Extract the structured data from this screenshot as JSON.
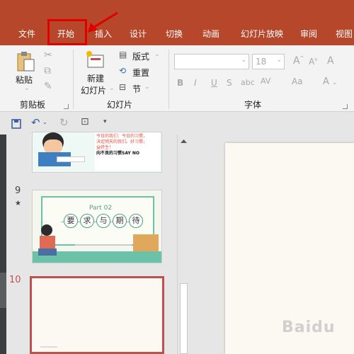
{
  "tabs": [
    "文件",
    "开始",
    "插入",
    "设计",
    "切换",
    "动画",
    "幻灯片放映",
    "审阅",
    "视图"
  ],
  "active_tab": "开始",
  "ribbon": {
    "clipboard": {
      "paste_label": "粘贴",
      "group_label": "剪贴板"
    },
    "slides": {
      "new_slide_line1": "新建",
      "new_slide_line2": "幻灯片",
      "layout_label": "版式",
      "reset_label": "重置",
      "section_label": "节",
      "group_label": "幻灯片"
    },
    "font": {
      "font_name": "",
      "font_size": "18",
      "group_label": "字体",
      "bold": "B",
      "italic": "I",
      "underline": "U",
      "strike": "S",
      "av": "AV",
      "aa": "Aa",
      "grow": "A",
      "shrink": "A",
      "clear": "A"
    }
  },
  "thumbnails": {
    "slide8_text_lines": [
      "今日的我们：今日的习惯，",
      "决定明天的我们。好习惯，",
      "益终生！",
      "向不良的习惯SAY NO"
    ],
    "slide9_number": "9",
    "slide9_star": "★",
    "slide9_part": "Part 02",
    "slide9_title_chars": [
      "要",
      "求",
      "与",
      "期",
      "待"
    ],
    "slide10_number": "10"
  },
  "colors": {
    "accent": "#b7472a",
    "highlight": "#e00000",
    "selected": "#c0504d"
  }
}
